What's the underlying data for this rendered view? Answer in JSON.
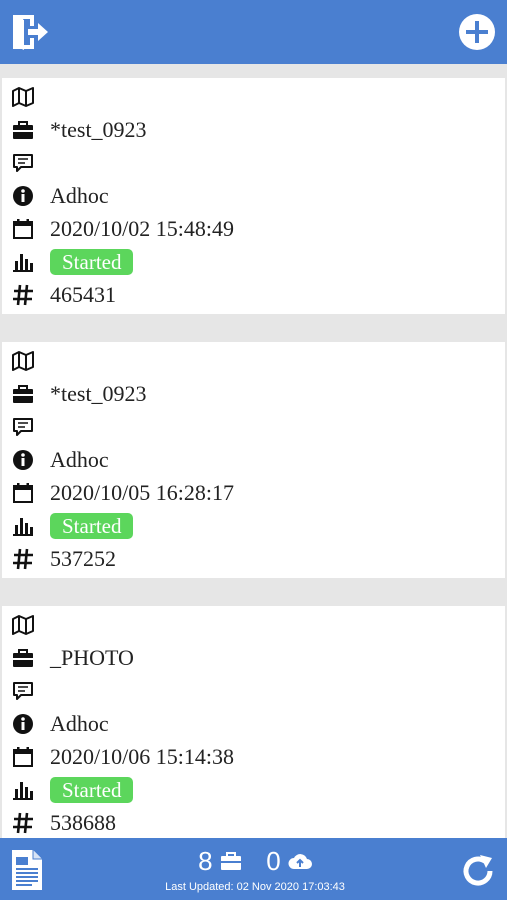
{
  "header": {
    "logout_icon": "logout-icon",
    "add_icon": "plus-circle-icon"
  },
  "jobs": [
    {
      "map": "",
      "job_name": "*test_0923",
      "comment": "",
      "type": "Adhoc",
      "date": "2020/10/02 15:48:49",
      "status": "Started",
      "id": "465431"
    },
    {
      "map": "",
      "job_name": "*test_0923",
      "comment": "",
      "type": "Adhoc",
      "date": "2020/10/05 16:28:17",
      "status": "Started",
      "id": "537252"
    },
    {
      "map": "",
      "job_name": "_PHOTO",
      "comment": "",
      "type": "Adhoc",
      "date": "2020/10/06 15:14:38",
      "status": "Started",
      "id": "538688"
    }
  ],
  "footer": {
    "jobs_count": "8",
    "upload_count": "0",
    "last_updated": "Last Updated: 02 Nov 2020 17:03:43"
  },
  "colors": {
    "bar": "#4a7fd0",
    "status_started": "#5cd65c"
  }
}
